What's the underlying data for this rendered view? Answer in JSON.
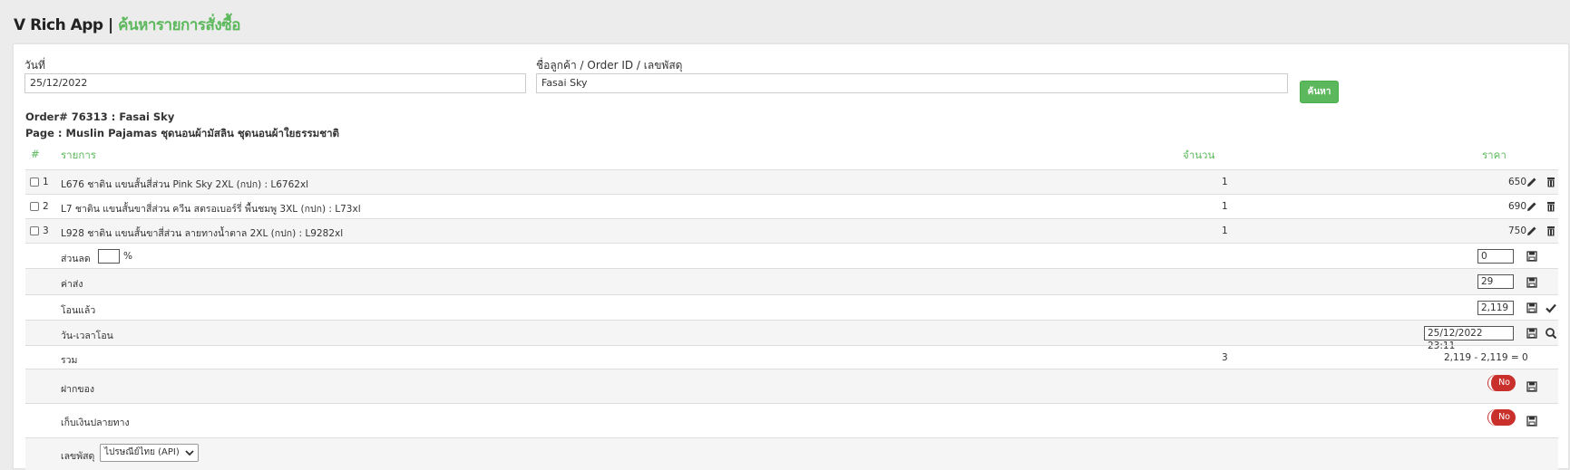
{
  "header": {
    "app_name": "V Rich App |",
    "page_title": "ค้นหารายการสั่งซื้อ"
  },
  "search": {
    "date_label": "วันที่",
    "date_value": "25/12/2022",
    "query_label": "ชื่อลูกค้า / Order ID / เลขพัสดุ",
    "query_value": "Fasai Sky",
    "button_label": "ค้นหา"
  },
  "order": {
    "order_line": "Order# 76313 : Fasai Sky",
    "page_line": "Page : Muslin Pajamas ชุดนอนผ้ามัสลิน ชุดนอนผ้าใยธรรมชาติ"
  },
  "table": {
    "headers": {
      "num": "#",
      "item": "รายการ",
      "qty": "จำนวน",
      "price": "ราคา"
    },
    "rows": [
      {
        "num": "1",
        "item": "L676 ชาติน แขนสั้นสี่ส่วน Pink Sky 2XL (กปก) : L6762xl",
        "qty": "1",
        "price": "650"
      },
      {
        "num": "2",
        "item": "L7 ชาติน แขนสั้นขาสี่ส่วน ควีน สตรอเบอร์รี่ พื้นชมพู 3XL (กปก) : L73xl",
        "qty": "1",
        "price": "690"
      },
      {
        "num": "3",
        "item": "L928 ชาติน แขนสั้นขาสี่ส่วน ลายทางน้ำตาล 2XL (กปก) : L9282xl",
        "qty": "1",
        "price": "750"
      }
    ]
  },
  "summary": {
    "discount_label": "ส่วนลด",
    "discount_percent_value": "",
    "percent_sign": "%",
    "discount_value": "0",
    "shipping_label": "ค่าส่ง",
    "shipping_value": "29",
    "transferred_label": "โอนแล้ว",
    "transferred_value": "2,119",
    "transfer_time_label": "วัน-เวลาโอน",
    "transfer_time_value": "25/12/2022 23:11",
    "total_label": "รวม",
    "total_qty": "3",
    "total_formula": "2,119 - 2,119 = 0",
    "deposit_label": "ฝากของ",
    "deposit_toggle": "No",
    "cod_label": "เก็บเงินปลายทาง",
    "cod_toggle": "No",
    "tracking_label": "เลขพัสดุ",
    "carrier_selected": "ไปรษณีย์ไทย (API)"
  },
  "colors": {
    "accent": "#5cb85c",
    "danger": "#c9302c",
    "background": "#ececec"
  }
}
